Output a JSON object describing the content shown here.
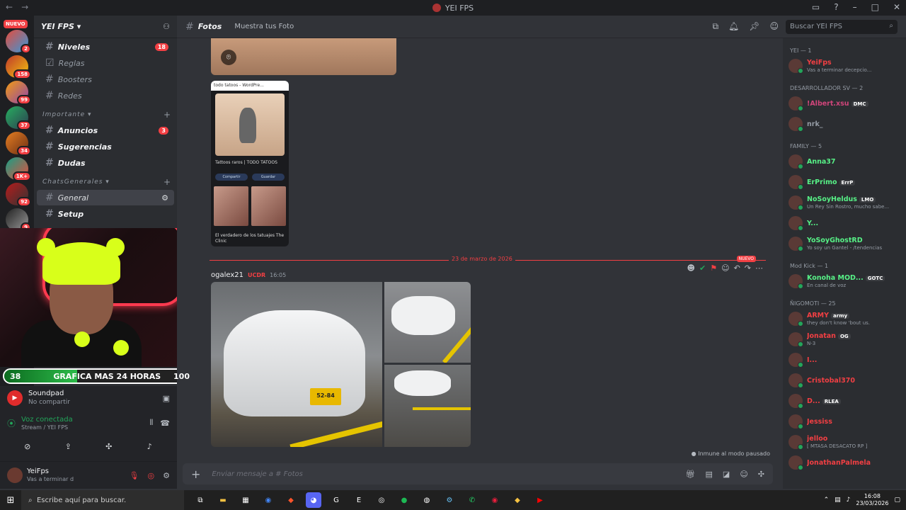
{
  "window": {
    "title": "YEI FPS"
  },
  "servers": {
    "new_label": "NUEVO",
    "badges": [
      "2",
      "158",
      "99",
      "37",
      "34",
      "1K+",
      "92",
      "9"
    ]
  },
  "sidebar": {
    "guild_name": "YEI FPS",
    "channels_top": [
      {
        "name": "Niveles",
        "count": "18",
        "bold": true
      },
      {
        "name": "Reglas",
        "bold": false
      },
      {
        "name": "Boosters",
        "bold": false
      },
      {
        "name": "Redes",
        "bold": false
      }
    ],
    "cat_importante": "Importante",
    "channels_importante": [
      {
        "name": "Anuncios",
        "count": "3",
        "bold": true
      },
      {
        "name": "Sugerencias",
        "bold": true
      },
      {
        "name": "Dudas",
        "bold": true
      }
    ],
    "cat_chats": "ChatsGenerales",
    "channels_chats": [
      {
        "name": "General",
        "selected": true
      },
      {
        "name": "Setup",
        "bold": true
      }
    ]
  },
  "overlay": {
    "progress_left": "38",
    "progress_label": "GRAFICA MAS 24 HORAS",
    "progress_right": "100",
    "progress_fraction": 0.38
  },
  "activity": {
    "app": "Soundpad",
    "status": "No compartir"
  },
  "voice": {
    "title": "Voz conectada",
    "channel": "Stream / YEI FPS"
  },
  "user": {
    "name": "YeiFps",
    "status": "Vas a terminar d"
  },
  "header": {
    "channel": "Fotos",
    "topic": "Muestra tus Foto",
    "search_placeholder": "Buscar YEI FPS"
  },
  "chat": {
    "phone_title": "todo tatoos - WordPre...",
    "phone_caption": "Tattoos raros | TODO TATOOS",
    "phone_btn1": "Compartir",
    "phone_btn2": "Guardar",
    "phone_source": "El verdadero de los tatuajes The Clinic",
    "divider_date": "23 de marzo de 2026",
    "divider_new": "NUEVO",
    "author": "ogalex21",
    "author_tag": "UCDR",
    "time": "16:05",
    "plate": "52-84",
    "immune": "Inmune al modo pausado"
  },
  "composer": {
    "placeholder": "Enviar mensaje a #",
    "channel": "Fotos"
  },
  "members": {
    "groups": [
      {
        "title": "YEI — 1",
        "members": [
          {
            "name": "YeiFps",
            "color": "#f23f43",
            "status": "Vas a terminar decepcio..."
          }
        ]
      },
      {
        "title": "DESARROLLADOR SV — 2",
        "members": [
          {
            "name": "!Albert.xsu",
            "color": "#d0457a",
            "badge": "DMC",
            "status": ""
          },
          {
            "name": "nrk_",
            "color": "#949ba4",
            "status": ""
          }
        ]
      },
      {
        "title": "FAMILY — 5",
        "members": [
          {
            "name": "Anna37",
            "color": "#57f287",
            "status": ""
          },
          {
            "name": "ErPrimo",
            "color": "#57f287",
            "badge": "ErrP",
            "status": ""
          },
          {
            "name": "NoSoyHeldus",
            "color": "#57f287",
            "badge": "LMO",
            "status": "Un Rey Sin Rostro, mucho sabe..."
          },
          {
            "name": "Y...",
            "color": "#57f287",
            "status": ""
          },
          {
            "name": "YoSoyGhostRD",
            "color": "#57f287",
            "status": "Yo soy un Gantel - /tendencias"
          }
        ]
      },
      {
        "title": "Mod Kick — 1",
        "members": [
          {
            "name": "Konoha MOD...",
            "color": "#57f287",
            "badge": "GOTC",
            "status": "En canal de voz"
          }
        ]
      },
      {
        "title": "ÑIGOMOTI — 25",
        "members": [
          {
            "name": "ARMY",
            "color": "#f23f43",
            "badge": "army",
            "status": "they don't know 'bout us."
          },
          {
            "name": "Jonatan",
            "color": "#f23f43",
            "badge": "OG",
            "status": "N-3"
          },
          {
            "name": "I...",
            "color": "#f23f43",
            "status": ""
          },
          {
            "name": "Cristobal370",
            "color": "#f23f43",
            "status": ""
          },
          {
            "name": "D...",
            "color": "#f23f43",
            "badge": "RLEA",
            "status": ""
          },
          {
            "name": "Jessiss",
            "color": "#f23f43",
            "status": ""
          },
          {
            "name": "jelloo",
            "color": "#f23f43",
            "status": "[ MTASA DESACATO RP ]"
          },
          {
            "name": "JonathanPalmela",
            "color": "#f23f43",
            "status": ""
          }
        ]
      }
    ]
  },
  "taskbar": {
    "search": "Escribe aquí para buscar.",
    "time": "16:08",
    "date": "23/03/2026"
  }
}
